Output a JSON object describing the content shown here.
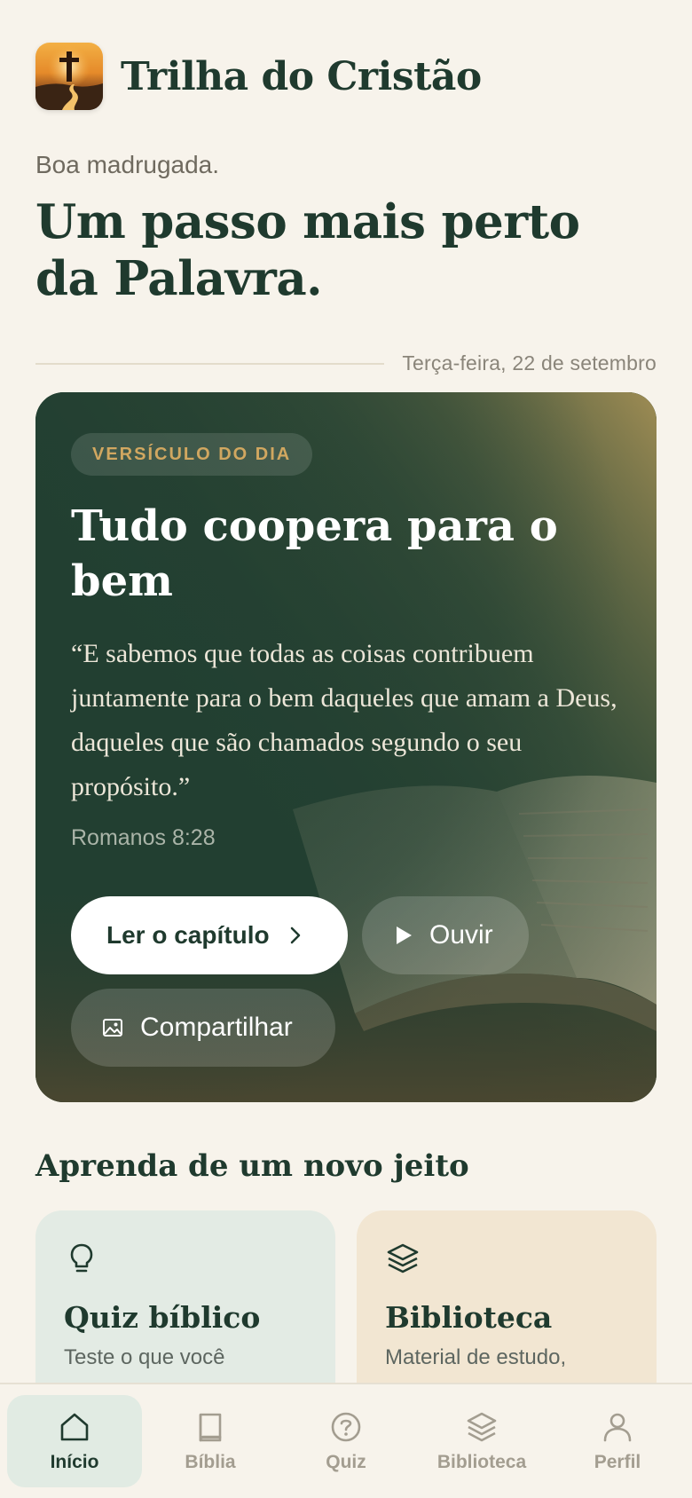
{
  "app": {
    "title": "Trilha do Cristão",
    "logo_icon": "cross-path-sunset-icon"
  },
  "greeting": "Boa madrugada.",
  "headline": "Um passo mais perto da Palavra.",
  "date": "Terça-feira, 22 de setembro",
  "verse": {
    "badge": "VERSÍCULO DO DIA",
    "title": "Tudo coopera para o bem",
    "text": "“E sabemos que todas as coisas contribuem juntamente para o bem daqueles que amam a Deus, daqueles que são chamados segundo o seu propósito.”",
    "reference": "Romanos 8:28",
    "buttons": {
      "read": "Ler o capítulo",
      "listen": "Ouvir",
      "share": "Compartilhar"
    }
  },
  "learn": {
    "title": "Aprenda de um novo jeito",
    "cards": [
      {
        "title": "Quiz bíblico",
        "description": "Teste o que você",
        "icon": "lightbulb-icon"
      },
      {
        "title": "Biblioteca",
        "description": "Material de estudo,",
        "icon": "layers-icon"
      }
    ]
  },
  "nav": {
    "items": [
      {
        "label": "Início",
        "icon": "home-icon",
        "active": true
      },
      {
        "label": "Bíblia",
        "icon": "book-icon",
        "active": false
      },
      {
        "label": "Quiz",
        "icon": "question-circle-icon",
        "active": false
      },
      {
        "label": "Biblioteca",
        "icon": "layers-icon",
        "active": false
      },
      {
        "label": "Perfil",
        "icon": "user-icon",
        "active": false
      }
    ]
  },
  "colors": {
    "background": "#f7f3eb",
    "primary_green": "#1f3a2e",
    "card_green": "#223f31",
    "badge_gold": "#d1a760",
    "quiz_card": "#e3ebe4",
    "library_card": "#f2e6d2"
  }
}
